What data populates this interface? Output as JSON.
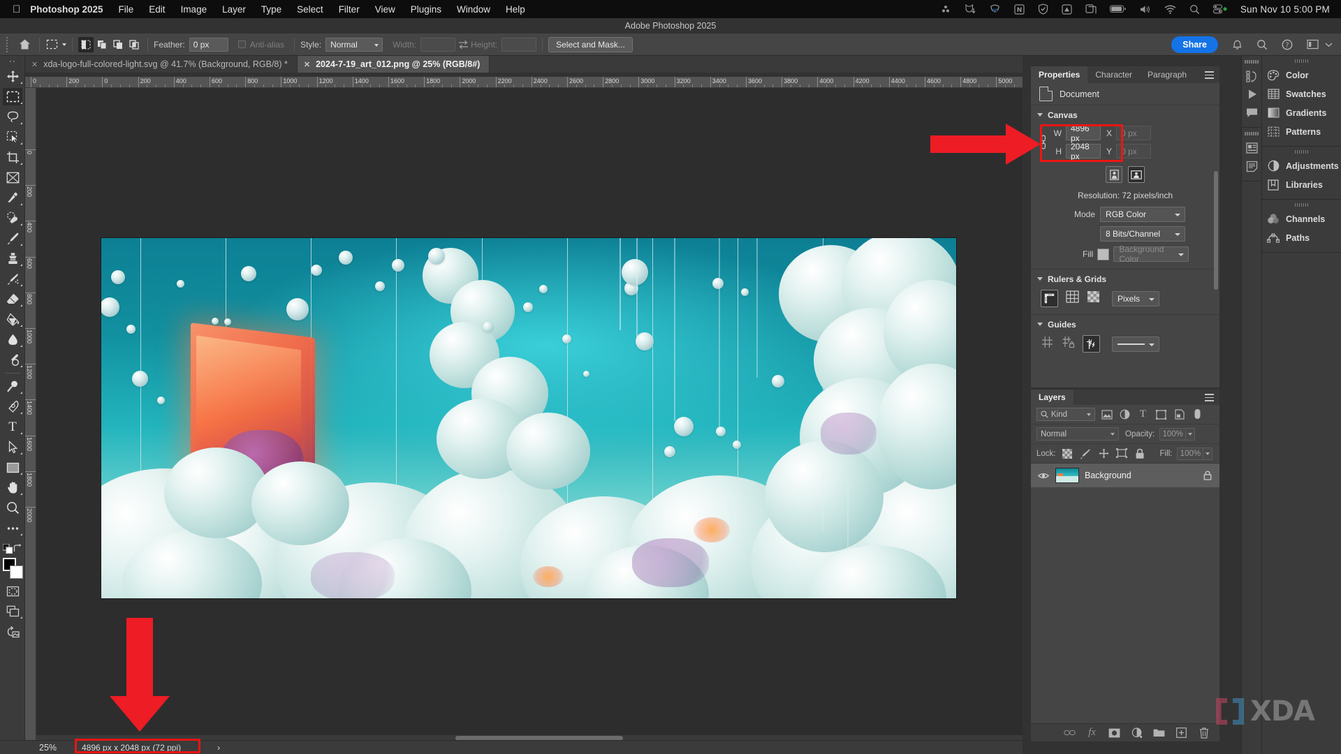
{
  "menubar": {
    "apple_icon": "apple-icon",
    "app_name": "Photoshop 2025",
    "items": [
      "File",
      "Edit",
      "Image",
      "Layer",
      "Type",
      "Select",
      "Filter",
      "View",
      "Plugins",
      "Window",
      "Help"
    ],
    "status_icons": [
      "dots-icon",
      "cat-download-icon",
      "dropbox-icon",
      "notion-icon",
      "shield-icon",
      "adobe-creative-cloud-icon",
      "stacks-icon",
      "battery-icon",
      "volume-icon",
      "wifi-icon",
      "search-icon",
      "control-center-icon"
    ],
    "clock": "Sun Nov 10  5:00 PM"
  },
  "titlebar": {
    "title": "Adobe Photoshop 2025"
  },
  "optionsbar": {
    "home_icon": "home-icon",
    "tool_preset": "marquee-tool-icon",
    "selection_modes": [
      "new-selection-icon",
      "add-to-selection-icon",
      "subtract-from-selection-icon",
      "intersect-selection-icon"
    ],
    "feather_label": "Feather:",
    "feather_value": "0 px",
    "antialias_label": "Anti-alias",
    "style_label": "Style:",
    "style_value": "Normal",
    "width_label": "Width:",
    "width_value": "",
    "swap_icon": "swap-width-height-icon",
    "height_label": "Height:",
    "height_value": "",
    "select_and_mask": "Select and Mask...",
    "share_label": "Share",
    "right_icons": [
      "bell-icon",
      "search-icon",
      "help-icon",
      "workspace-icon",
      "chevron-down-icon"
    ]
  },
  "tabs": [
    {
      "label": "xda-logo-full-colored-light.svg @ 41.7% (Background, RGB/8) *",
      "active": false
    },
    {
      "label": "2024-7-19_art_012.png @ 25% (RGB/8#)",
      "active": true
    }
  ],
  "ruler": {
    "unit": "Pixels",
    "labels": [
      "0",
      "200",
      "0",
      "200",
      "400",
      "600",
      "800",
      "1000",
      "1200",
      "1400",
      "1600",
      "1800",
      "2000",
      "2200",
      "2400",
      "2600",
      "2800",
      "3000",
      "3200",
      "3400",
      "3600",
      "3800",
      "4000",
      "4200",
      "4400",
      "4600",
      "4800",
      "5000",
      "5"
    ],
    "vertical_labels": [
      "0",
      "200",
      "400",
      "600",
      "800",
      "1000",
      "1200",
      "1400",
      "1600",
      "1800",
      "2000"
    ]
  },
  "toolbar": {
    "tools": [
      {
        "name": "move-tool",
        "icon": "move-icon",
        "selected": false
      },
      {
        "name": "rectangular-marquee-tool",
        "icon": "marquee-icon",
        "selected": true
      },
      {
        "name": "lasso-tool",
        "icon": "lasso-icon",
        "selected": false
      },
      {
        "name": "object-selection-tool",
        "icon": "object-select-icon",
        "selected": false
      },
      {
        "name": "crop-tool",
        "icon": "crop-icon",
        "selected": false
      },
      {
        "name": "frame-tool",
        "icon": "frame-icon",
        "selected": false
      },
      {
        "name": "eyedropper-tool",
        "icon": "eyedropper-icon",
        "selected": false
      },
      {
        "name": "spot-healing-brush-tool",
        "icon": "healing-brush-icon",
        "selected": false
      },
      {
        "name": "brush-tool",
        "icon": "brush-icon",
        "selected": false
      },
      {
        "name": "clone-stamp-tool",
        "icon": "clone-stamp-icon",
        "selected": false
      },
      {
        "name": "history-brush-tool",
        "icon": "history-brush-icon",
        "selected": false
      },
      {
        "name": "eraser-tool",
        "icon": "eraser-icon",
        "selected": false
      },
      {
        "name": "gradient-tool",
        "icon": "paint-bucket-icon",
        "selected": false
      },
      {
        "name": "blur-tool",
        "icon": "blur-drop-icon",
        "selected": false
      },
      {
        "name": "dodge-tool",
        "icon": "dodge-icon",
        "selected": false
      },
      {
        "name": "pen-tool",
        "icon": "pen-icon",
        "selected": false
      },
      {
        "name": "type-tool",
        "icon": "type-icon",
        "selected": false
      },
      {
        "name": "path-selection-tool",
        "icon": "path-arrow-icon",
        "selected": false
      },
      {
        "name": "rectangle-tool",
        "icon": "rectangle-icon",
        "selected": false
      },
      {
        "name": "hand-tool",
        "icon": "hand-icon",
        "selected": false
      },
      {
        "name": "zoom-tool",
        "icon": "magnifier-icon",
        "selected": false
      },
      {
        "name": "edit-toolbar",
        "icon": "ellipsis-icon",
        "selected": false
      }
    ],
    "foreground_color": "#000000",
    "background_color": "#ffffff",
    "quick_mask_icon": "quick-mask-icon",
    "screen-mode_icon": "screen-mode-icon",
    "share-image_icon": "share-image-icon"
  },
  "properties": {
    "tabs": [
      {
        "label": "Properties",
        "active": true
      },
      {
        "label": "Character",
        "active": false
      },
      {
        "label": "Paragraph",
        "active": false
      }
    ],
    "doc_label": "Document",
    "canvas": {
      "section_title": "Canvas",
      "w_label": "W",
      "w_value": "4896 px",
      "h_label": "H",
      "h_value": "2048 px",
      "x_label": "X",
      "x_value": "0 px",
      "y_label": "Y",
      "y_value": "0 px",
      "link_icon": "link-chain-icon",
      "orientation_portrait_icon": "portrait-orientation-icon",
      "orientation_landscape_icon": "landscape-orientation-icon",
      "resolution": "Resolution: 72 pixels/inch",
      "mode_label": "Mode",
      "mode_value": "RGB Color",
      "depth_value": "8 Bits/Channel",
      "fill_label": "Fill",
      "fill_value": "Background Color"
    },
    "rulers_grids": {
      "section_title": "Rulers & Grids",
      "ruler_icon": "ruler-icon",
      "grid_icon": "grid-icon",
      "transparency_icon": "transparency-checkerboard-icon",
      "unit_value": "Pixels"
    },
    "guides": {
      "section_title": "Guides",
      "show_guides_icon": "show-guides-icon",
      "lock_guides_icon": "lock-guides-icon",
      "snap_guides_icon": "snap-to-guides-icon",
      "style_value": "———————"
    }
  },
  "layers": {
    "tab_label": "Layers",
    "filter_placeholder": "Kind",
    "filter_icons": [
      "pixel-filter-icon",
      "adjustment-filter-icon",
      "type-filter-icon",
      "shape-filter-icon",
      "smart-object-filter-icon",
      "filter-toggle-icon"
    ],
    "blend_mode": "Normal",
    "opacity_label": "Opacity:",
    "opacity_value": "100%",
    "lock_label": "Lock:",
    "lock_icons": [
      "lock-transparent-pixels-icon",
      "lock-image-pixels-icon",
      "lock-position-icon",
      "lock-artboard-icon",
      "lock-all-icon"
    ],
    "fill_label": "Fill:",
    "fill_value": "100%",
    "items": [
      {
        "name": "Background",
        "visible": true,
        "locked": true,
        "thumb": "artwork-thumbnail"
      }
    ],
    "bottom_icons": [
      "link-layers-icon",
      "layer-style-fx-icon",
      "layer-mask-icon",
      "adjustment-layer-icon",
      "new-group-icon",
      "new-layer-icon",
      "delete-layer-icon"
    ]
  },
  "right_dock": {
    "mini_groups": [
      [
        "history-icon",
        "actions-play-icon",
        "comments-icon"
      ],
      [
        "layer-comps-icon",
        "notes-icon"
      ]
    ],
    "groups": [
      [
        {
          "label": "Color",
          "icon": "color-palette-icon"
        },
        {
          "label": "Swatches",
          "icon": "swatches-grid-icon"
        },
        {
          "label": "Gradients",
          "icon": "gradient-icon"
        },
        {
          "label": "Patterns",
          "icon": "patterns-icon"
        }
      ],
      [
        {
          "label": "Adjustments",
          "icon": "adjustments-circle-icon"
        },
        {
          "label": "Libraries",
          "icon": "libraries-book-icon"
        }
      ],
      [
        {
          "label": "Channels",
          "icon": "channels-venn-icon"
        },
        {
          "label": "Paths",
          "icon": "paths-pen-icon"
        }
      ]
    ]
  },
  "statusbar": {
    "zoom": "25%",
    "dimensions": "4896 px x 2048 px (72 ppi)",
    "chevron": "›"
  },
  "annotations": {
    "arrow_color": "#ee1c25",
    "highlight_color": "#f01414",
    "arrow_right_target": "canvas-width-height-fields",
    "arrow_down_target": "status-bar-dimensions"
  },
  "watermark": {
    "text": "XDA",
    "bracket_left_color": "#b8435e",
    "bracket_right_color": "#3f87b0",
    "text_color": "#9a9a9a"
  }
}
